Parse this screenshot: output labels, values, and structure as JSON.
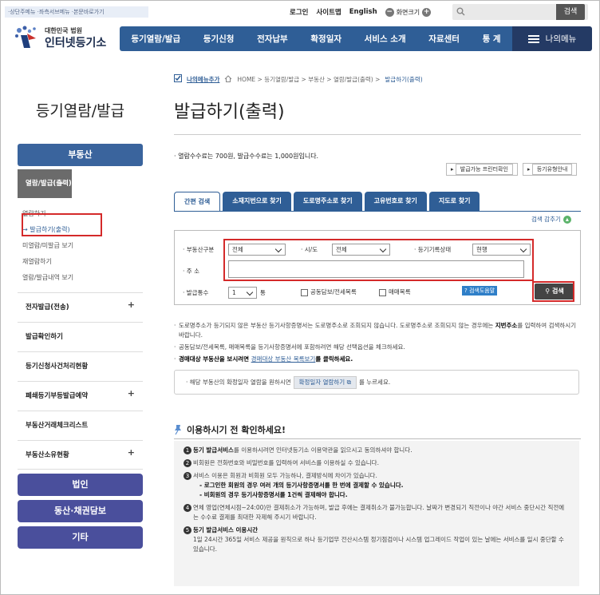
{
  "util_text": "·상단주메뉴 ·좌측서브메뉴 ·본문바로가기",
  "top_links": [
    "로그인",
    "사이트맵",
    "English"
  ],
  "zoom": {
    "label": "화면크기",
    "minus": "−",
    "plus": "+"
  },
  "search": {
    "placeholder": "",
    "button": "검색"
  },
  "logo": {
    "small": "대한민국 법원",
    "big": "인터넷등기소"
  },
  "gnb": [
    "등기열람/발급",
    "등기신청",
    "전자납부",
    "확정일자",
    "서비스 소개",
    "자료센터",
    "통 계"
  ],
  "my_menu": "나의메뉴",
  "lnb": {
    "title": "등기열람/발급",
    "category": "부동산",
    "selected": "열람/발급(출력)",
    "minus": "−",
    "sub": [
      "열람하기",
      "→ 발급하기(출력)",
      "미열람/미발급 보기",
      "재열람하기",
      "열람/발급내역 보기"
    ],
    "items": [
      {
        "label": "전자발급(전송)",
        "plus": "+"
      },
      {
        "label": "발급확인하기",
        "plus": ""
      },
      {
        "label": "등기신청사건처리현황",
        "plus": ""
      },
      {
        "label": "폐쇄등기부등발급예약",
        "plus": "+"
      },
      {
        "label": "부동산거래체크리스트",
        "plus": ""
      },
      {
        "label": "부동산소유현황",
        "plus": "+"
      }
    ],
    "buttons": [
      "법인",
      "동산·채권담보",
      "기타"
    ]
  },
  "breadcrumb": {
    "my_menu_add": "나의메뉴추가",
    "path": "HOME > 등기열람/발급 > 부동산 > 열람/발급(출력) >",
    "current": "발급하기(출력)"
  },
  "page_title": "발급하기(출력)",
  "fee_text": "열람수수료는 700원, 발급수수료는 1,000원입니다.",
  "small_buttons": [
    "발급가능 프린터확인",
    "등기유형안내"
  ],
  "tabs": [
    "간편 검색",
    "소재지번으로 찾기",
    "도로명주소로 찾기",
    "고유번호로 찾기",
    "지도로 찾기"
  ],
  "hide_link": "검색 감추기",
  "form": {
    "type_label": "부동산구분",
    "type_value": "전체",
    "sido_label": "시/도",
    "sido_value": "전체",
    "status_label": "등기기록상태",
    "status_value": "현행",
    "addr_label": "주 소",
    "addr_value": "",
    "count_label": "발급통수",
    "count_value": "1",
    "count_unit": "통",
    "cb1": "공동담보/전세목록",
    "cb2": "매매목록",
    "help": "검색도움말",
    "search": "검색"
  },
  "notes": [
    {
      "pre": "도로명주소가 등기되지 않은 부동산 등기사항증명서는 도로명주소로 조회되지 않습니다. 도로명주소로 조회되지 않는 경우에는 ",
      "bold": "지번주소",
      "post": "를 입력하여 검색하시기 바랍니다."
    },
    {
      "pre": "공동담보/전세목록, 매매목록을 등기사항증명서에 포함하려면 해당 선택옵션을 체크하세요.",
      "bold": "",
      "post": ""
    },
    {
      "pre": "",
      "bold": "경매대상 부동산을 보시려면 ",
      "link": "경매대상 부동산 목록보기",
      "post": "를 클릭하세요."
    }
  ],
  "notice_box": {
    "pre": "해당 부동산의 확정일자 열람을 원하시면",
    "button": "확정일자 열람하기",
    "post": "를 누르세요."
  },
  "check_title": "이용하시기 전 확인하세요!",
  "checks": [
    {
      "n": "1",
      "bold": "등기 발급서비스",
      "text": "를 이용하시려면 인터넷등기소 이용약관을 읽으시고 동의하셔야 합니다."
    },
    {
      "n": "2",
      "bold": "",
      "text": "비회원은 전화번호와 비밀번호를 입력하여 서비스를 이용하실 수 있습니다."
    },
    {
      "n": "3",
      "bold": "",
      "text": "서비스 이용은 회원과 비회원 모두 가능하나, 결제방식에 차이가 있습니다.",
      "sub": [
        "- 로그인한 회원의 경우 여러 개의 등기사항증명서를 한 번에 결제할 수 있습니다.",
        "- 비회원의 경우 등기사항증명서를 1건씩 결제해야 합니다."
      ]
    },
    {
      "n": "4",
      "bold": "",
      "text": "연체 영업(연체시점~24:00)만 결제취소가 가능하며, 발급 후에는 결제취소가 불가능합니다. 날짜가 변경되기 직전이나 야간 서비스 중단시간 직전에는 수수료 결제를 최대한 자제해 주시기 바랍니다."
    },
    {
      "n": "5",
      "bold": "등기 발급서비스 이용시간",
      "text": "",
      "sub": [
        "1일 24시간 365일 서비스 제공을 원칙으로 하나 등기업무 전산시스템 정기점검이나 시스템 업그레이드 작업이 있는 날에는 서비스를 일시 중단할 수 있습니다."
      ]
    }
  ]
}
